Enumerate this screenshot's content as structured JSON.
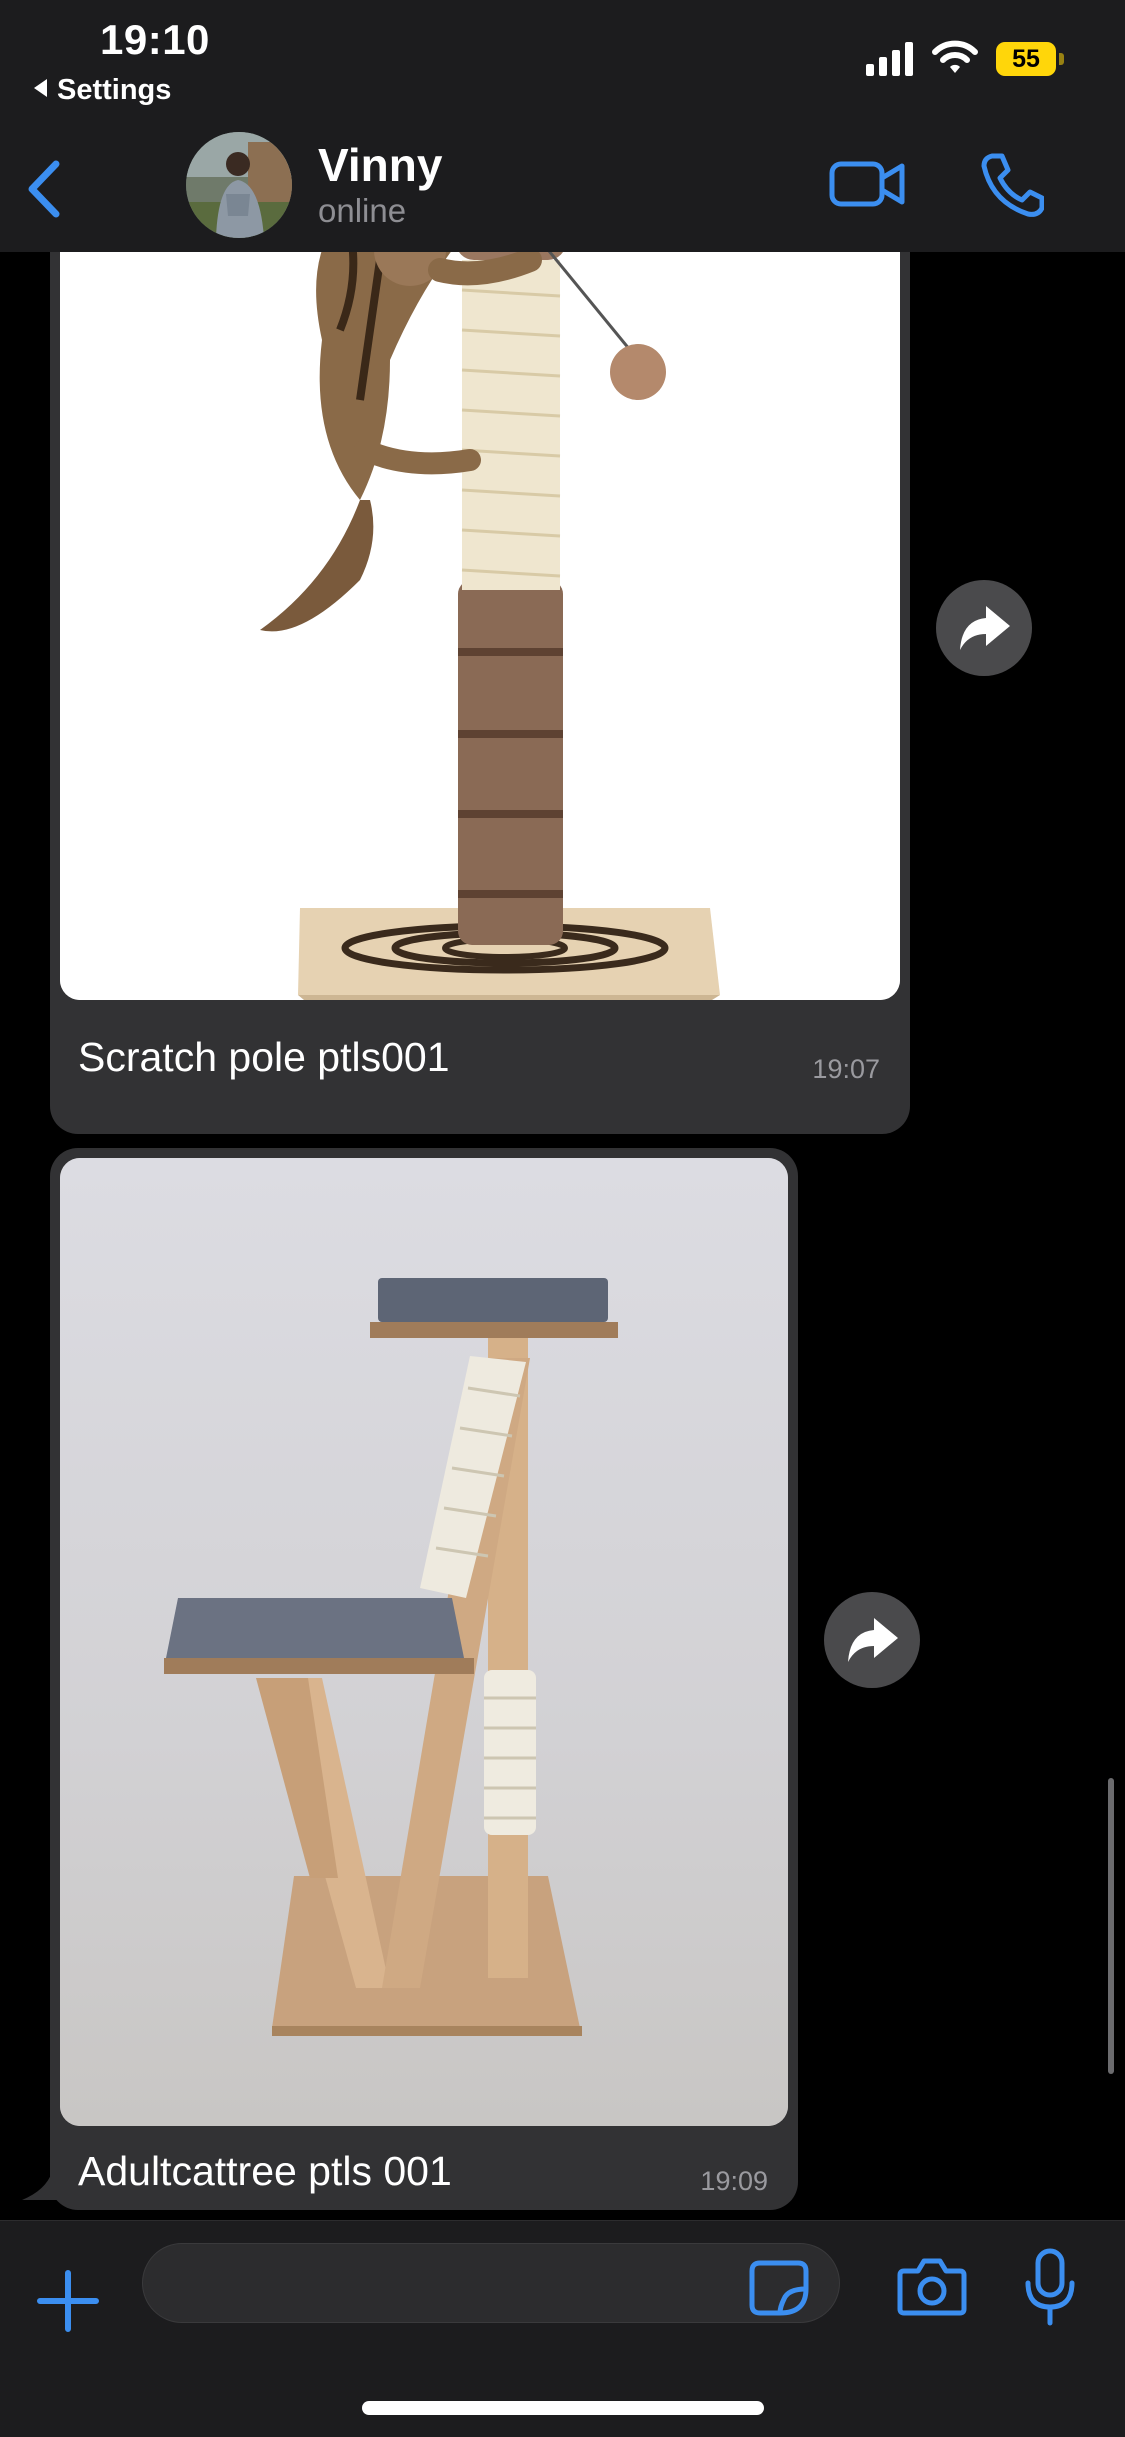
{
  "status_bar": {
    "time": "19:10",
    "back_label": "Settings",
    "battery_level": "55",
    "icons": [
      "signal-icon",
      "wifi-icon",
      "battery-icon"
    ]
  },
  "header": {
    "contact_name": "Vinny",
    "contact_status": "online",
    "icons": [
      "back-chevron-icon",
      "video-camera-icon",
      "phone-icon"
    ]
  },
  "messages": [
    {
      "caption": "Scratch pole ptls001",
      "time": "19:07"
    },
    {
      "caption": "Adultcattree ptls 001",
      "time": "19:09"
    }
  ],
  "input_bar": {
    "placeholder": "",
    "icons": [
      "plus-icon",
      "sticker-icon",
      "camera-icon",
      "microphone-icon"
    ]
  },
  "colors": {
    "accent": "#3b8ef0",
    "bubble": "#323234",
    "bars": "#1c1c1e",
    "background": "#000000",
    "battery": "#ffd60a"
  }
}
